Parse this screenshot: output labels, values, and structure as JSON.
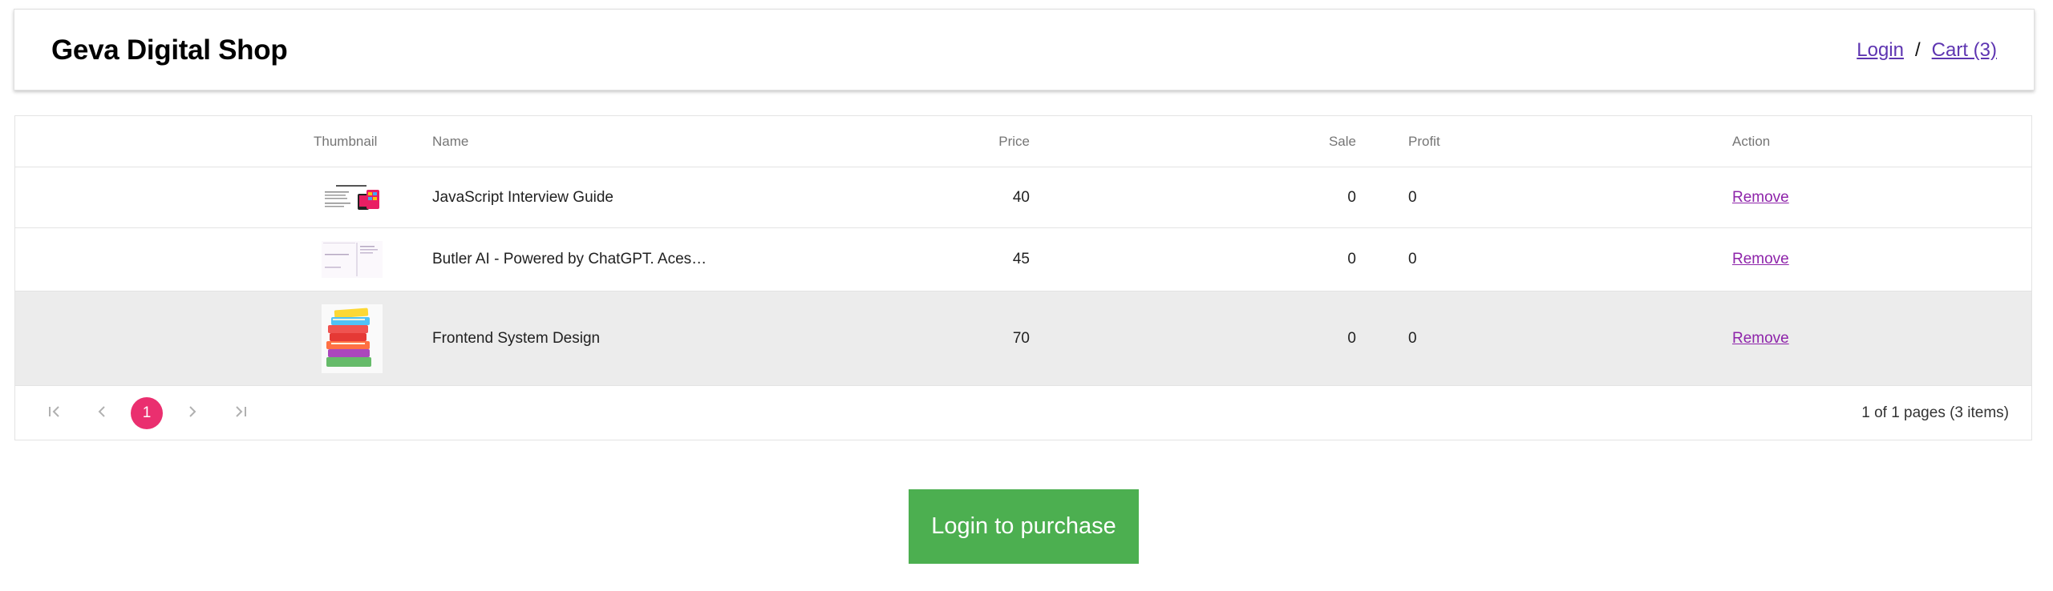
{
  "header": {
    "title": "Geva Digital Shop",
    "login_label": "Login",
    "separator": "/",
    "cart_label": "Cart (3)"
  },
  "table": {
    "columns": [
      "Thumbnail",
      "Name",
      "Price",
      "Sale",
      "Profit",
      "Action"
    ],
    "rows": [
      {
        "thumbnail": "javascript-interview-guide-thumbnail",
        "name": "JavaScript Interview Guide",
        "price": "40",
        "sale": "0",
        "profit": "0",
        "action": "Remove"
      },
      {
        "thumbnail": "butler-ai-thumbnail",
        "name": "Butler AI - Powered by ChatGPT. Aces…",
        "price": "45",
        "sale": "0",
        "profit": "0",
        "action": "Remove"
      },
      {
        "thumbnail": "book-stack-thumbnail",
        "name": "Frontend System Design",
        "price": "70",
        "sale": "0",
        "profit": "0",
        "action": "Remove"
      }
    ],
    "highlighted_row": 3
  },
  "pager": {
    "first_icon": "first-page-icon",
    "prev_icon": "chevron-left-icon",
    "current_page": "1",
    "next_icon": "chevron-right-icon",
    "last_icon": "last-page-icon",
    "info": "1 of 1 pages (3 items)"
  },
  "purchase": {
    "label": "Login to purchase"
  },
  "colors": {
    "accent_pink": "#e91e63",
    "purchase_green": "#4caf50",
    "link_purple": "#5e35b1",
    "remove_purple": "#8e24aa",
    "selected_row": "#ececec"
  }
}
